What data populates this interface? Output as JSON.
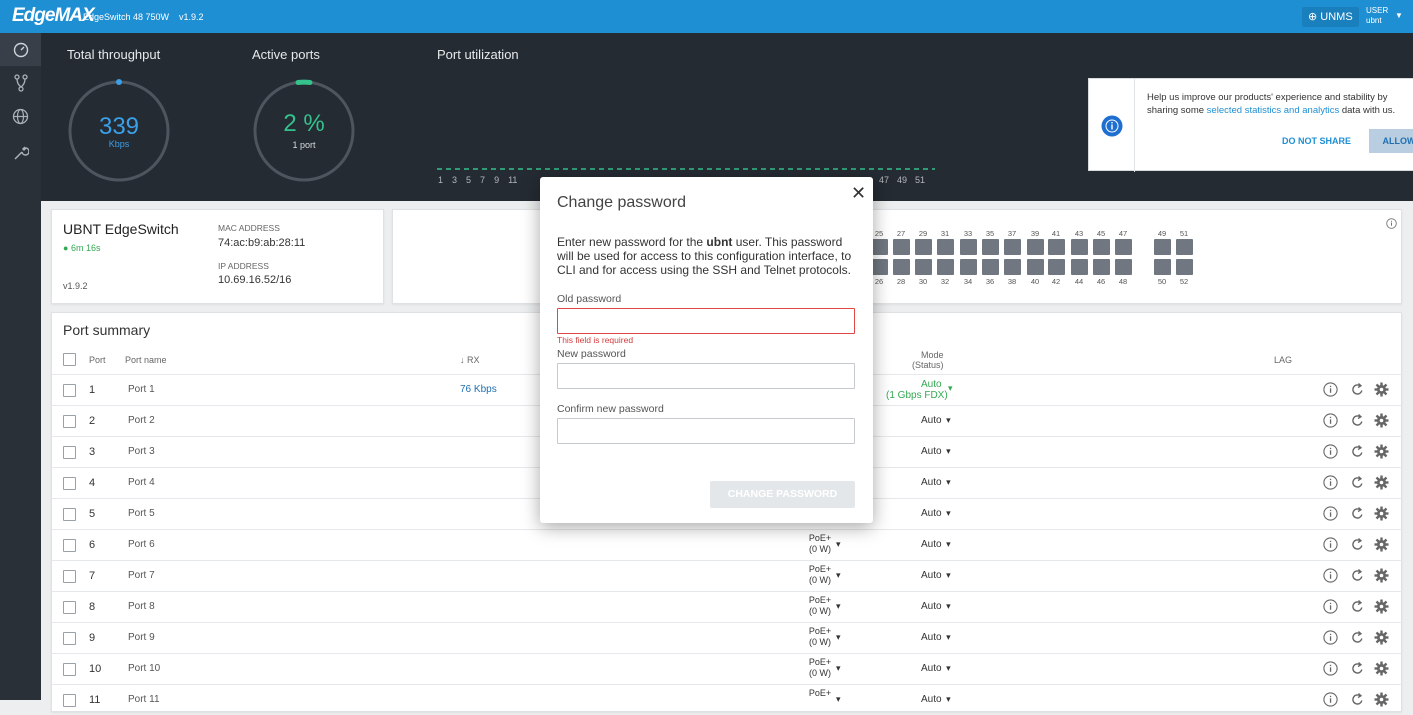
{
  "topbar": {
    "logo": "EdgeMAX",
    "model": "EdgeSwitch 48 750W",
    "version": "v1.9.2",
    "unms_label": "UNMS",
    "user_label": "USER",
    "user_name": "ubnt"
  },
  "dashboard": {
    "throughput": {
      "title": "Total throughput",
      "value": "339",
      "unit": "Kbps"
    },
    "active_ports": {
      "title": "Active ports",
      "value": "2 %",
      "sub": "1 port",
      "percent": 2
    },
    "utilization": {
      "title": "Port utilization",
      "ticks": [
        "1",
        "3",
        "5",
        "7",
        "9",
        "11"
      ],
      "ticks_right": [
        "47",
        "49",
        "51"
      ]
    }
  },
  "consent": {
    "text_a": "Help us improve our products' experience and stability by sharing some ",
    "link": "selected statistics and analytics",
    "text_b": " data with us.",
    "deny": "DO NOT SHARE",
    "allow": "ALLOW"
  },
  "device": {
    "name": "UBNT EdgeSwitch",
    "uptime": "6m 16s",
    "version": "v1.9.2",
    "mac_label": "MAC ADDRESS",
    "mac": "74:ac:b9:ab:28:11",
    "ip_label": "IP ADDRESS",
    "ip": "10.69.16.52/16"
  },
  "ports_panel": {
    "top": [
      "25",
      "27",
      "29",
      "31",
      "33",
      "35",
      "37",
      "39",
      "41",
      "43",
      "45",
      "47",
      "49",
      "51"
    ],
    "bottom": [
      "26",
      "28",
      "30",
      "32",
      "34",
      "36",
      "38",
      "40",
      "42",
      "44",
      "46",
      "48",
      "50",
      "52"
    ]
  },
  "port_summary": {
    "title": "Port summary",
    "headers": {
      "port": "Port",
      "name": "Port name",
      "rx": "↓ RX",
      "mode": "Mode",
      "mode_sub": "(Status)",
      "lag": "LAG"
    },
    "rows": [
      {
        "no": "1",
        "name": "Port 1",
        "rx": "76 Kbps",
        "mode": "Auto",
        "status": "(1 Gbps FDX)"
      },
      {
        "no": "2",
        "name": "Port 2",
        "mode": "Auto"
      },
      {
        "no": "3",
        "name": "Port 3",
        "mode": "Auto"
      },
      {
        "no": "4",
        "name": "Port 4",
        "mode": "Auto"
      },
      {
        "no": "5",
        "name": "Port 5",
        "mode": "Auto"
      },
      {
        "no": "6",
        "name": "Port 6",
        "poe": "PoE+",
        "poe_w": "(0 W)",
        "mode": "Auto"
      },
      {
        "no": "7",
        "name": "Port 7",
        "poe": "PoE+",
        "poe_w": "(0 W)",
        "mode": "Auto"
      },
      {
        "no": "8",
        "name": "Port 8",
        "poe": "PoE+",
        "poe_w": "(0 W)",
        "mode": "Auto"
      },
      {
        "no": "9",
        "name": "Port 9",
        "poe": "PoE+",
        "poe_w": "(0 W)",
        "mode": "Auto"
      },
      {
        "no": "10",
        "name": "Port 10",
        "poe": "PoE+",
        "poe_w": "(0 W)",
        "mode": "Auto"
      },
      {
        "no": "11",
        "name": "Port 11",
        "poe": "PoE+",
        "mode": "Auto"
      }
    ]
  },
  "modal": {
    "title": "Change password",
    "desc_a": "Enter new password for the ",
    "desc_user": "ubnt",
    "desc_b": " user. This password will be used for access to this configuration interface, to CLI and for access using the SSH and Telnet protocols.",
    "old_label": "Old password",
    "error": "This field is required",
    "new_label": "New password",
    "confirm_label": "Confirm new password",
    "submit": "CHANGE PASSWORD"
  },
  "colors": {
    "topbar": "#1f8fd4",
    "sidebar": "#2a3038",
    "dashboard": "#252b33",
    "accent_green": "#34c18c",
    "error": "#e04848"
  }
}
